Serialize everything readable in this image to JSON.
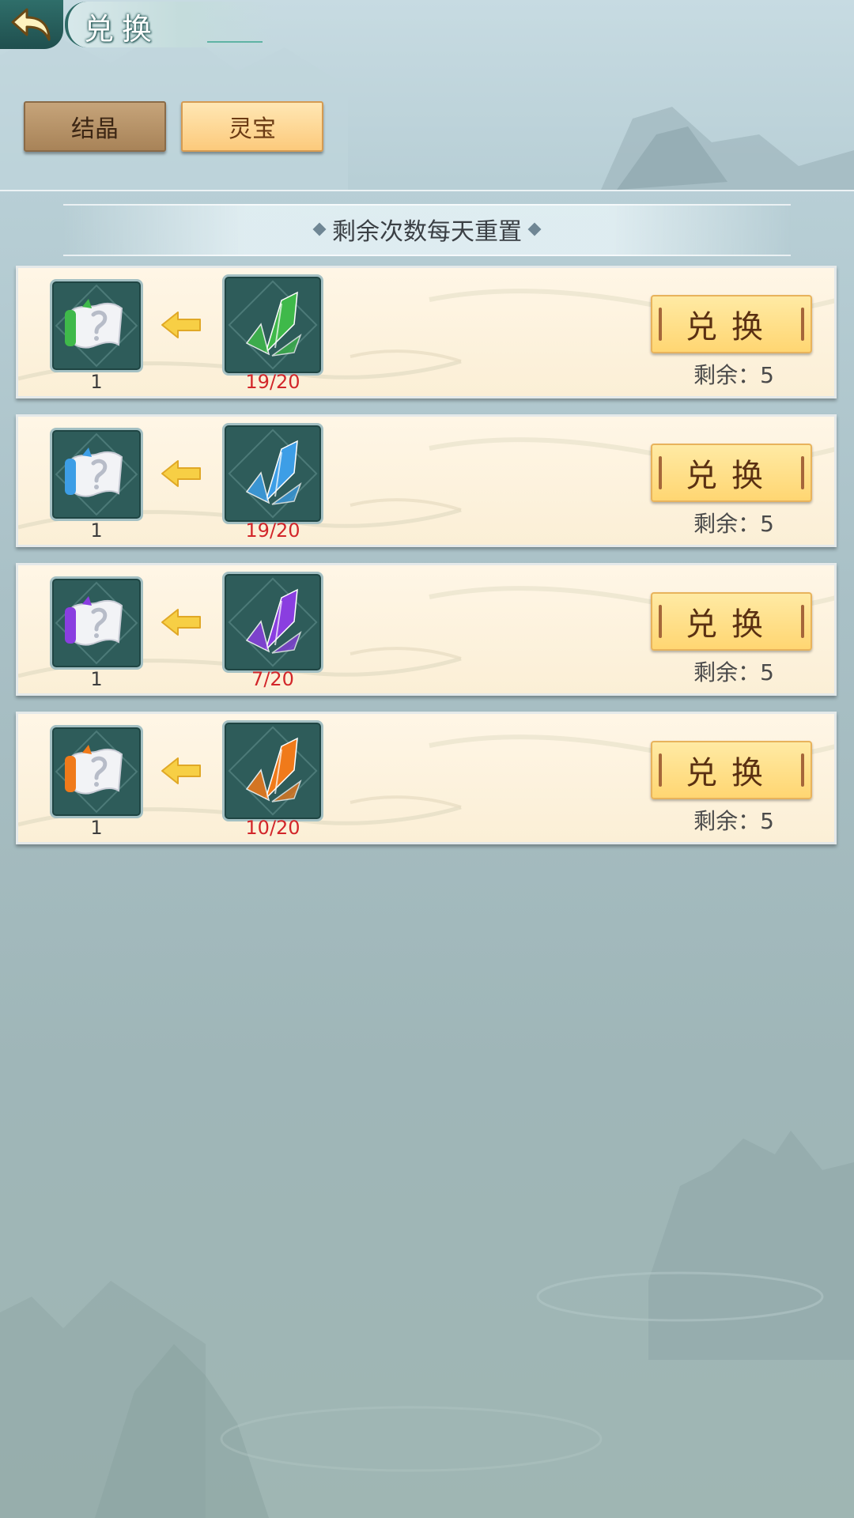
{
  "header": {
    "title": "兑换",
    "back_icon": "back-arrow-icon"
  },
  "tabs": [
    {
      "label": "结晶",
      "active": false
    },
    {
      "label": "灵宝",
      "active": true
    }
  ],
  "notice": "剩余次数每天重置",
  "rows": [
    {
      "reward_icon": "green-scroll-icon",
      "reward_qty": "1",
      "cost_icon": "green-crystal-icon",
      "cost_qty": "19/20",
      "button": "兑换",
      "remaining": "剩余：5",
      "color": "#3fb94a"
    },
    {
      "reward_icon": "blue-scroll-icon",
      "reward_qty": "1",
      "cost_icon": "blue-crystal-icon",
      "cost_qty": "19/20",
      "button": "兑换",
      "remaining": "剩余：5",
      "color": "#3d9ee6"
    },
    {
      "reward_icon": "purple-scroll-icon",
      "reward_qty": "1",
      "cost_icon": "purple-crystal-icon",
      "cost_qty": "7/20",
      "button": "兑换",
      "remaining": "剩余：5",
      "color": "#8a3ee0"
    },
    {
      "reward_icon": "orange-scroll-icon",
      "reward_qty": "1",
      "cost_icon": "orange-crystal-icon",
      "cost_qty": "10/20",
      "button": "兑换",
      "remaining": "剩余：5",
      "color": "#f07a1a"
    }
  ],
  "colors": {
    "accent": "#ffd672",
    "cost_text": "#d2262a",
    "icon_bg": "#2e5c5a"
  }
}
